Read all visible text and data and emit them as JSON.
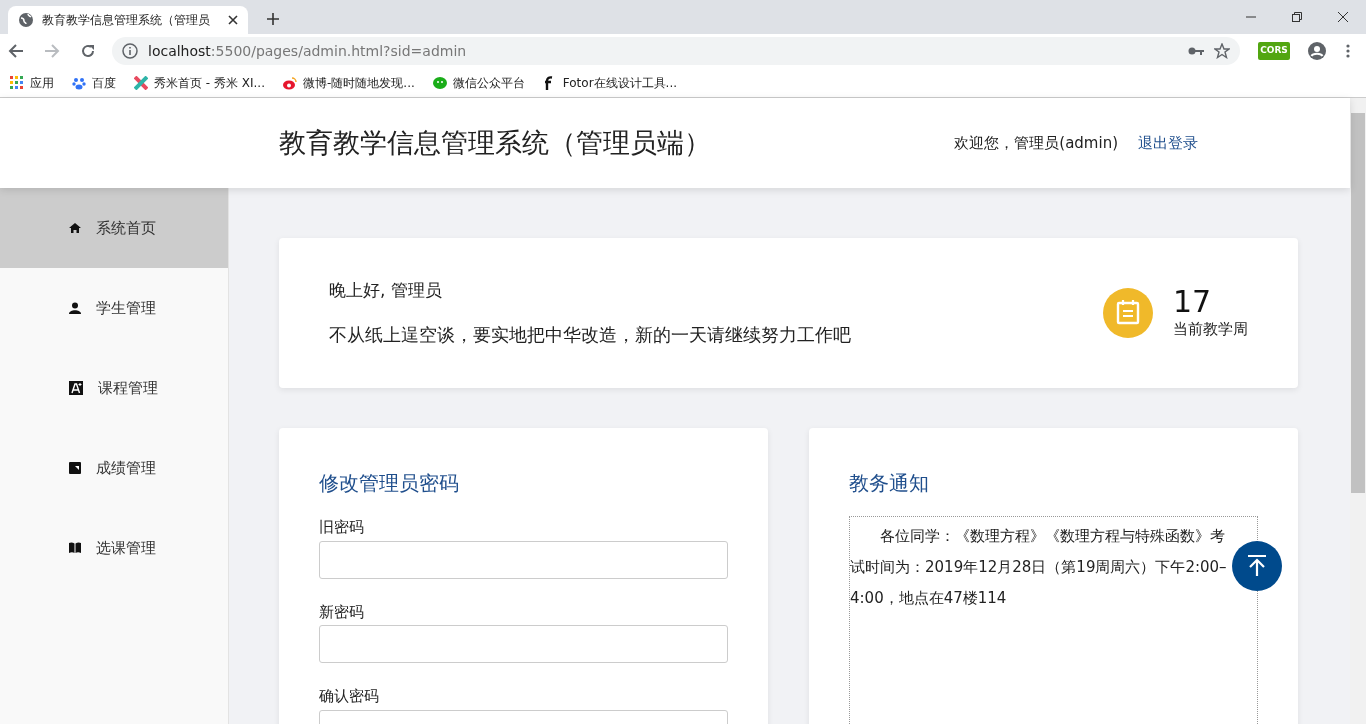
{
  "browser": {
    "tab_title": "教育教学信息管理系统（管理员",
    "url_host": "localhost",
    "url_rest": ":5500/pages/admin.html?sid=admin",
    "bookmarks": [
      {
        "kind": "apps",
        "label": "应用"
      },
      {
        "kind": "paw",
        "label": "百度"
      },
      {
        "kind": "xiumi",
        "label": "秀米首页 - 秀米 XI..."
      },
      {
        "kind": "weibo",
        "label": "微博-随时随地发现..."
      },
      {
        "kind": "wechat",
        "label": "微信公众平台"
      },
      {
        "kind": "fotor",
        "label": "Fotor在线设计工具..."
      }
    ],
    "extension_label": "CORS"
  },
  "header": {
    "title": "教育教学信息管理系统（管理员端）",
    "welcome": "欢迎您，管理员(admin)",
    "logout": "退出登录"
  },
  "sidebar": {
    "items": [
      {
        "kind": "home",
        "label": "系统首页",
        "selected": true
      },
      {
        "kind": "person",
        "label": "学生管理",
        "selected": false
      },
      {
        "kind": "course",
        "label": "课程管理",
        "selected": false
      },
      {
        "kind": "grade",
        "label": "成绩管理",
        "selected": false
      },
      {
        "kind": "book",
        "label": "选课管理",
        "selected": false
      }
    ]
  },
  "greeting": {
    "hello": "晚上好, 管理员",
    "motto": "不从纸上逞空谈，要实地把中华改造，新的一天请继续努力工作吧",
    "week_number": "17",
    "week_label": "当前教学周"
  },
  "password_form": {
    "title": "修改管理员密码",
    "fields": [
      {
        "label": "旧密码"
      },
      {
        "label": "新密码"
      },
      {
        "label": "确认密码"
      }
    ]
  },
  "notice": {
    "title": "教务通知",
    "text": "各位同学：《数理方程》《数理方程与特殊函数》考试时间为：2019年12月28日（第19周周六）下午2:00–4:00，地点在47楼114"
  }
}
